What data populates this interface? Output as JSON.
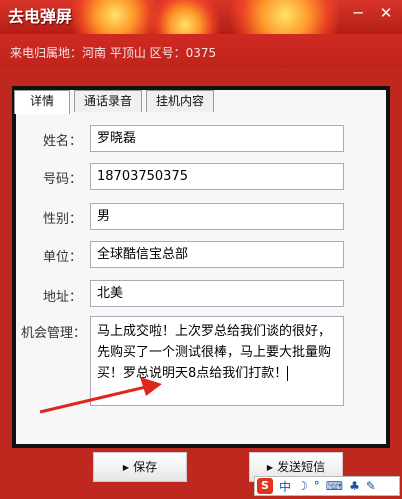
{
  "window": {
    "title": "去电弹屏",
    "min_symbol": "─",
    "close_symbol": "✕"
  },
  "caller_info": "来电归属地：河南 平顶山 区号：0375",
  "tabs": [
    {
      "label": "详情",
      "active": true
    },
    {
      "label": "通话录音",
      "active": false
    },
    {
      "label": "挂机内容",
      "active": false
    }
  ],
  "form": {
    "name_label": "姓名：",
    "name_value": "罗晓磊",
    "number_label": "号码：",
    "number_value": "18703750375",
    "gender_label": "性别：",
    "gender_value": "男",
    "company_label": "单位：",
    "company_value": "全球酷信宝总部",
    "address_label": "地址：",
    "address_value": "北美",
    "opportunity_label": "机会管理：",
    "opportunity_value": "马上成交啦！上次罗总给我们谈的很好，\n先购买了一个测试很棒，马上要大批量购\n买！罗总说明天8点给我们打款！"
  },
  "buttons": {
    "save": "保存",
    "send_sms": "发送短信"
  },
  "ime": {
    "logo": "S",
    "mode": "中",
    "moon": "☽",
    "dot": "°",
    "items": [
      "⌨",
      "♣",
      "✎"
    ]
  },
  "colors": {
    "window_red": "#c0271f",
    "arrow_red": "#e0261c"
  }
}
